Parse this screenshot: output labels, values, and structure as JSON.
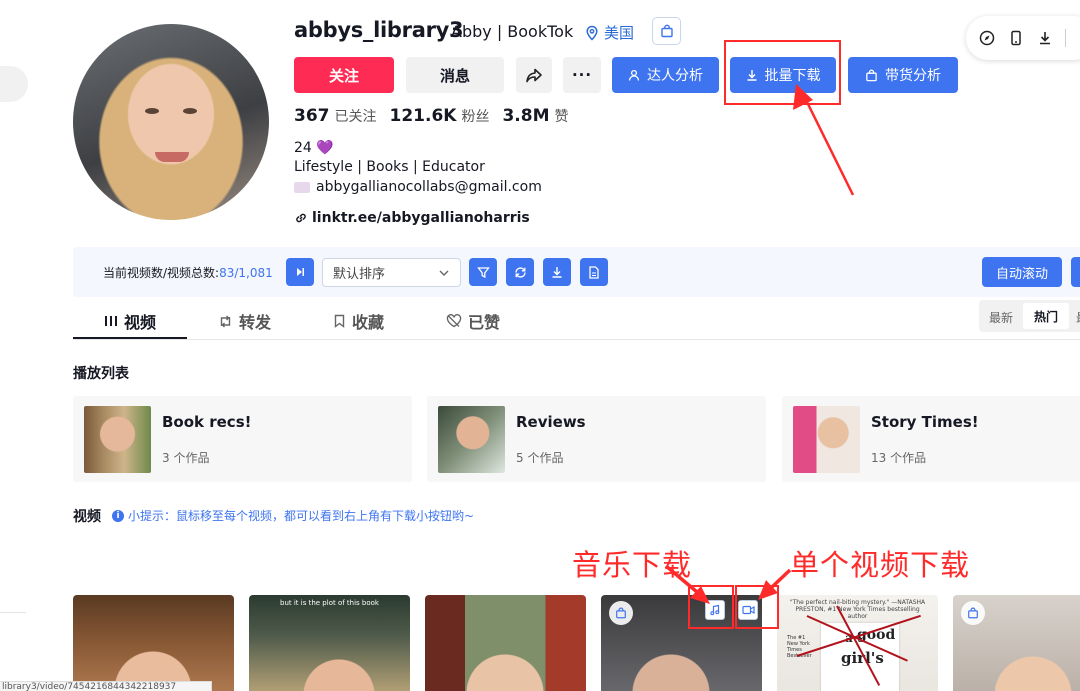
{
  "profile": {
    "username": "abbys_library3",
    "nickname": "Abby | BookTok",
    "region": "美国",
    "stats": {
      "following_value": "367",
      "following_label": "已关注",
      "followers_value": "121.6K",
      "followers_label": "粉丝",
      "likes_value": "3.8M",
      "likes_label": "赞"
    },
    "bio_line1": "24 💜",
    "bio_line2": "Lifestyle | Books | Educator",
    "bio_email": "abbygallianocollabs@gmail.com",
    "link": "linktr.ee/abbygallianoharris"
  },
  "actions": {
    "follow": "关注",
    "message": "消息",
    "more": "···",
    "creator_analysis": "达人分析",
    "batch_download": "批量下载",
    "goods_analysis": "带货分析"
  },
  "toolbar": {
    "count_label": "当前视频数/视频总数:",
    "count_current": "83",
    "count_total": "/1,081",
    "sort_selected": "默认排序",
    "auto_scroll": "自动滚动"
  },
  "tabs": [
    {
      "label": "视频",
      "active": true
    },
    {
      "label": "转发",
      "active": false
    },
    {
      "label": "收藏",
      "active": false
    },
    {
      "label": "已赞",
      "active": false
    }
  ],
  "sort_segment": {
    "latest": "最新",
    "hot": "热门",
    "cut": "最"
  },
  "playlists": {
    "title": "播放列表",
    "items": [
      {
        "name": "Book recs!",
        "count": "3 个作品"
      },
      {
        "name": "Reviews",
        "count": "5 个作品"
      },
      {
        "name": "Story Times!",
        "count": "13 个作品"
      }
    ]
  },
  "videos": {
    "title": "视频",
    "tip": "小提示：鼠标移至每个视频，都可以看到右上角有下载小按钮哟~",
    "tip_icon": "i",
    "card2_caption": "but it is the plot of this book",
    "card5_tagline": "\"The perfect nail-biting mystery.\" —NATASHA PRESTON, #1 New York Times bestselling author",
    "card5_side": "The #1 New York Times Bestseller",
    "card5_book_a": "a",
    "card5_book_good": "good",
    "card5_book_girls": "girl's"
  },
  "annotations": {
    "music_download": "音乐下载",
    "single_video_download": "单个视频下载"
  },
  "status_url": "library3/video/7454216844342218937",
  "colors": {
    "follow": "#fe2c55",
    "primary": "#3e74f0",
    "annotation": "#ff2b2b"
  }
}
